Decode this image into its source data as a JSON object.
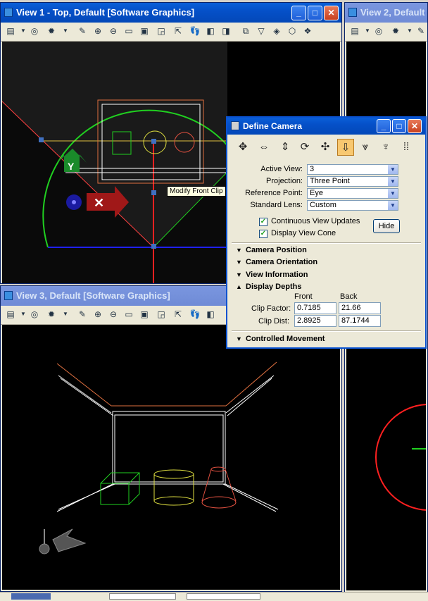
{
  "views": {
    "view1_title": "View 1 - Top, Default [Software Graphics]",
    "view2_title": "View 2, Default",
    "view3_title": "View 3, Default [Software Graphics]"
  },
  "tooltip": "Modify Front Clip",
  "dialog": {
    "title": "Define Camera",
    "active_view_label": "Active View:",
    "active_view_value": "3",
    "projection_label": "Projection:",
    "projection_value": "Three Point",
    "reference_point_label": "Reference Point:",
    "reference_point_value": "Eye",
    "standard_lens_label": "Standard Lens:",
    "standard_lens_value": "Custom",
    "continuous_updates_label": "Continuous View Updates",
    "display_cone_label": "Display View Cone",
    "hide_label": "Hide",
    "sections": {
      "camera_position": "Camera Position",
      "camera_orientation": "Camera Orientation",
      "view_information": "View Information",
      "display_depths": "Display Depths",
      "controlled_movement": "Controlled Movement"
    },
    "depths": {
      "front_header": "Front",
      "back_header": "Back",
      "clip_factor_label": "Clip Factor:",
      "clip_factor_front": "0.7185",
      "clip_factor_back": "21.66",
      "clip_dist_label": "Clip Dist:",
      "clip_dist_front": "2.8925",
      "clip_dist_back": "87.1744"
    }
  },
  "colors": {
    "title_active": "#0550c8",
    "viewport_bg": "#000000",
    "dialog_bg": "#ece9d8"
  }
}
